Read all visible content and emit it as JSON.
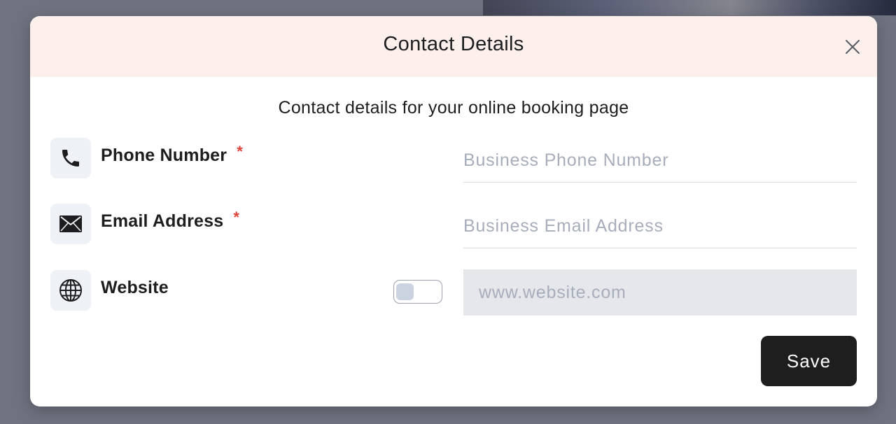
{
  "dialog": {
    "title": "Contact Details",
    "subtitle": "Contact details for your online booking page",
    "close_icon": "close-icon",
    "header_color": "#fcefec"
  },
  "fields": {
    "phone": {
      "label": "Phone Number",
      "required_mark": "*",
      "icon": "phone-icon",
      "placeholder": "Business Phone Number",
      "value": ""
    },
    "email": {
      "label": "Email Address",
      "required_mark": "*",
      "icon": "envelope-icon",
      "placeholder": "Business Email Address",
      "value": ""
    },
    "website": {
      "label": "Website",
      "icon": "globe-icon",
      "placeholder": "www.website.com",
      "value": "",
      "toggle_enabled": false
    }
  },
  "actions": {
    "save_label": "Save"
  },
  "colors": {
    "required": "#e0443a",
    "primary_button": "#1e1e1e",
    "placeholder": "#a7adbb"
  }
}
